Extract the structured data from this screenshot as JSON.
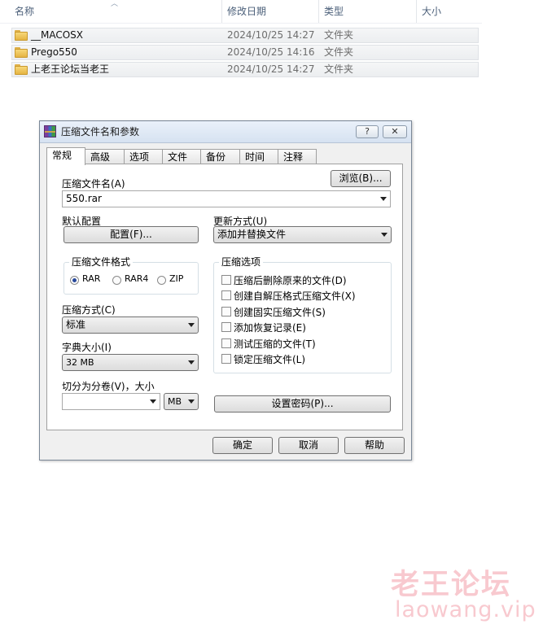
{
  "file_list": {
    "columns": {
      "name": "名称",
      "date": "修改日期",
      "type": "类型",
      "size": "大小"
    },
    "rows": [
      {
        "name": "__MACOSX",
        "date": "2024/10/25 14:27",
        "type": "文件夹"
      },
      {
        "name": "Prego550",
        "date": "2024/10/25 14:16",
        "type": "文件夹"
      },
      {
        "name": "上老王论坛当老王",
        "date": "2024/10/25 14:27",
        "type": "文件夹"
      }
    ]
  },
  "dialog": {
    "title": "压缩文件名和参数",
    "help_btn": "?",
    "close_btn": "✕",
    "tabs": [
      "常规",
      "高级",
      "选项",
      "文件",
      "备份",
      "时间",
      "注释"
    ],
    "archive_name_label": "压缩文件名(A)",
    "browse_btn": "浏览(B)...",
    "archive_name_value": "550.rar",
    "default_profile_label": "默认配置",
    "profile_btn": "配置(F)...",
    "update_mode_label": "更新方式(U)",
    "update_mode_value": "添加并替换文件",
    "format_group_label": "压缩文件格式",
    "formats": [
      {
        "label": "RAR",
        "checked": true
      },
      {
        "label": "RAR4",
        "checked": false
      },
      {
        "label": "ZIP",
        "checked": false
      }
    ],
    "compression_method_label": "压缩方式(C)",
    "compression_method_value": "标准",
    "dict_size_label": "字典大小(I)",
    "dict_size_value": "32 MB",
    "split_label": "切分为分卷(V)，大小",
    "split_value": "",
    "split_unit": "MB",
    "options_group_label": "压缩选项",
    "options": [
      "压缩后删除原来的文件(D)",
      "创建自解压格式压缩文件(X)",
      "创建固实压缩文件(S)",
      "添加恢复记录(E)",
      "测试压缩的文件(T)",
      "锁定压缩文件(L)"
    ],
    "password_btn": "设置密码(P)...",
    "ok_btn": "确定",
    "cancel_btn": "取消",
    "help_bottom_btn": "帮助"
  },
  "watermark": {
    "line1": "老王论坛",
    "line2": "laowang.vip"
  }
}
